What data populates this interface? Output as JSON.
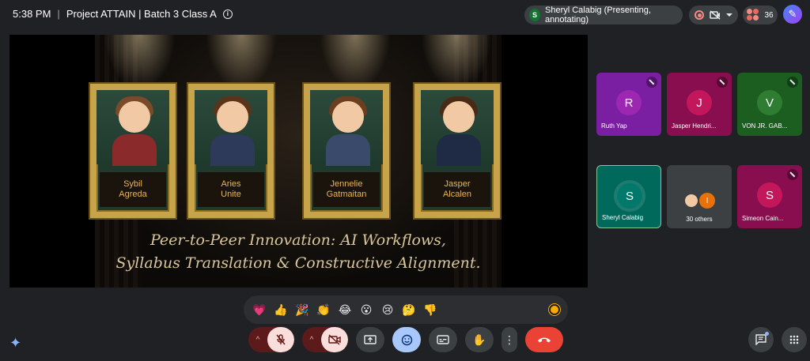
{
  "header": {
    "time": "5:38 PM",
    "separator": "|",
    "meeting_title": "Project ATTAIN | Batch 3 Class A",
    "presenter_initial": "S",
    "presenter_label": "Sheryl Calabig (Presenting, annotating)",
    "participant_count": "36"
  },
  "slide": {
    "presenters": [
      {
        "name": "Sybil\nAgreda"
      },
      {
        "name": "Aries\nUnite"
      },
      {
        "name": "Jennelie\nGatmaitan"
      },
      {
        "name": "Jasper\nAlcalen"
      }
    ],
    "caption_line1": "Peer-to-Peer Innovation: AI Workflows,",
    "caption_line2": "Syllabus Translation & Constructive Alignment."
  },
  "participants": [
    {
      "initial": "R",
      "name": "Ruth Yap",
      "tile_color": "#7b1fa2",
      "avatar_color": "#9c27b0",
      "muted": true
    },
    {
      "initial": "J",
      "name": "Jasper Hendri...",
      "tile_color": "#880e4f",
      "avatar_color": "#c2185b",
      "muted": true
    },
    {
      "initial": "V",
      "name": "VON JR. GAB...",
      "tile_color": "#1b5e20",
      "avatar_color": "#2e7d32",
      "muted": true
    },
    {
      "initial": "S",
      "name": "Sheryl Calabig",
      "tile_color": "#00695c",
      "avatar_color": "#00796b",
      "muted": false
    },
    {
      "initial": "",
      "name": "30 others",
      "tile_color": "#3c4043",
      "avatar_color": "#3c4043",
      "muted": false
    },
    {
      "initial": "S",
      "name": "Simeon Cain...",
      "tile_color": "#880e4f",
      "avatar_color": "#c2185b",
      "muted": true
    }
  ],
  "others_avatar_initial": "I",
  "reactions": [
    "💗",
    "👍",
    "🎉",
    "👏",
    "😂",
    "😮",
    "😢",
    "🤔",
    "👎"
  ],
  "icons": {
    "info": "i",
    "gemini": "✦",
    "sparkle": "✎",
    "caret": "^",
    "mic_off": "🎙",
    "cam_off": "📷",
    "present": "⬆",
    "react": "☺",
    "captions": "CC",
    "hand": "✋",
    "more": "⋮",
    "end": "☎",
    "chat": "✉",
    "apps": "⋮⋮"
  }
}
